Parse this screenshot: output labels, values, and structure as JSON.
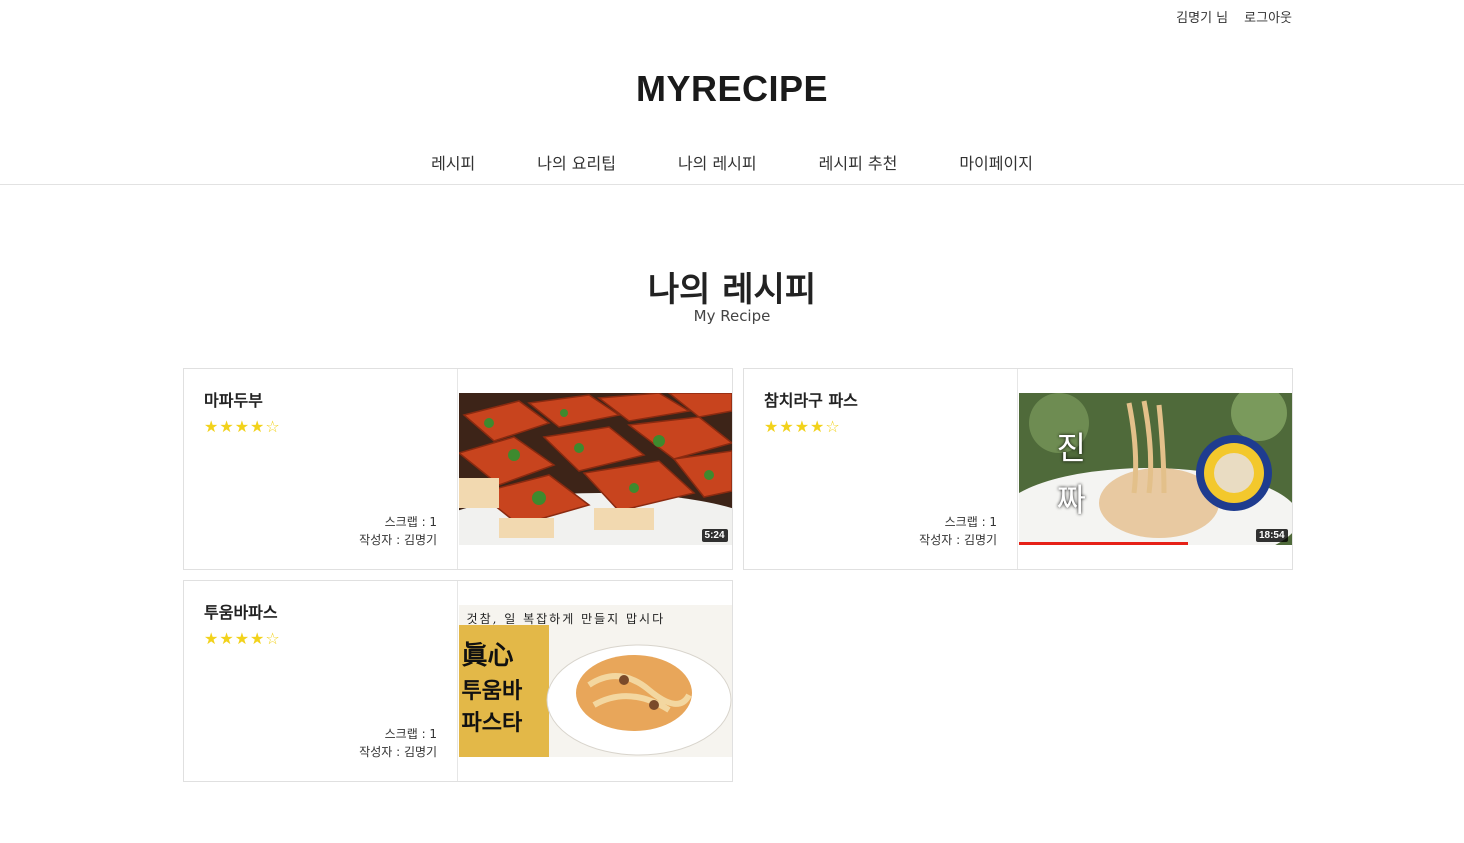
{
  "header": {
    "user_label": "김명기 님",
    "logout_label": "로그아웃",
    "logo": "MYRECIPE"
  },
  "nav": {
    "items": [
      {
        "label": "레시피"
      },
      {
        "label": "나의 요리팁"
      },
      {
        "label": "나의 레시피"
      },
      {
        "label": "레시피 추천"
      },
      {
        "label": "마이페이지"
      }
    ]
  },
  "section": {
    "title": "나의 레시피",
    "subtitle": "My Recipe"
  },
  "cards": [
    {
      "name": "마파두부",
      "rating": 4,
      "rating_max": 5,
      "scrap": "스크랩 : 1",
      "author": "작성자 : 김명기",
      "duration": "5:24",
      "thumb_theme": "tofu"
    },
    {
      "name": "참치라구 파스",
      "rating": 4,
      "rating_max": 5,
      "scrap": "스크랩 : 1",
      "author": "작성자 : 김명기",
      "duration": "18:54",
      "thumb_theme": "tuna",
      "thumb_text": [
        "진",
        "짜"
      ],
      "thumb_progress": 0.62
    },
    {
      "name": "투움바파스",
      "rating": 4,
      "rating_max": 5,
      "scrap": "스크랩 : 1",
      "author": "작성자 : 김명기",
      "thumb_theme": "pasta",
      "thumb_top_text": "것참, 일 복잡하게 만들지 맙시다",
      "thumb_side_text": [
        "眞心",
        "투움바",
        "파스타"
      ]
    }
  ],
  "colors": {
    "star": "#f2d21b",
    "border": "#e0e0e0"
  }
}
